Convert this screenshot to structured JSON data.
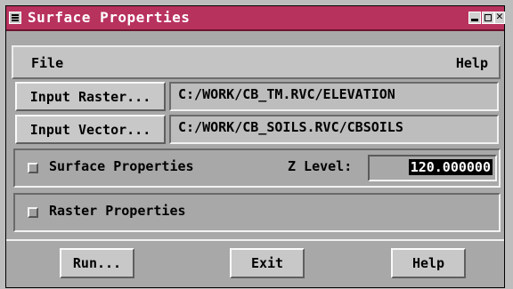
{
  "window": {
    "title": "Surface Properties"
  },
  "menu": {
    "file": "File",
    "help": "Help"
  },
  "inputs": {
    "raster_button": "Input Raster...",
    "raster_path": "C:/WORK/CB_TM.RVC/ELEVATION",
    "vector_button": "Input Vector...",
    "vector_path": "C:/WORK/CB_SOILS.RVC/CBSOILS"
  },
  "surface": {
    "label": "Surface Properties",
    "z_label": "Z Level:",
    "z_value": "120.000000"
  },
  "raster": {
    "label": "Raster Properties"
  },
  "buttons": {
    "run": "Run...",
    "exit": "Exit",
    "help": "Help"
  },
  "colors": {
    "titlebar": "#b8325e",
    "window_bg": "#a8a8a8"
  }
}
